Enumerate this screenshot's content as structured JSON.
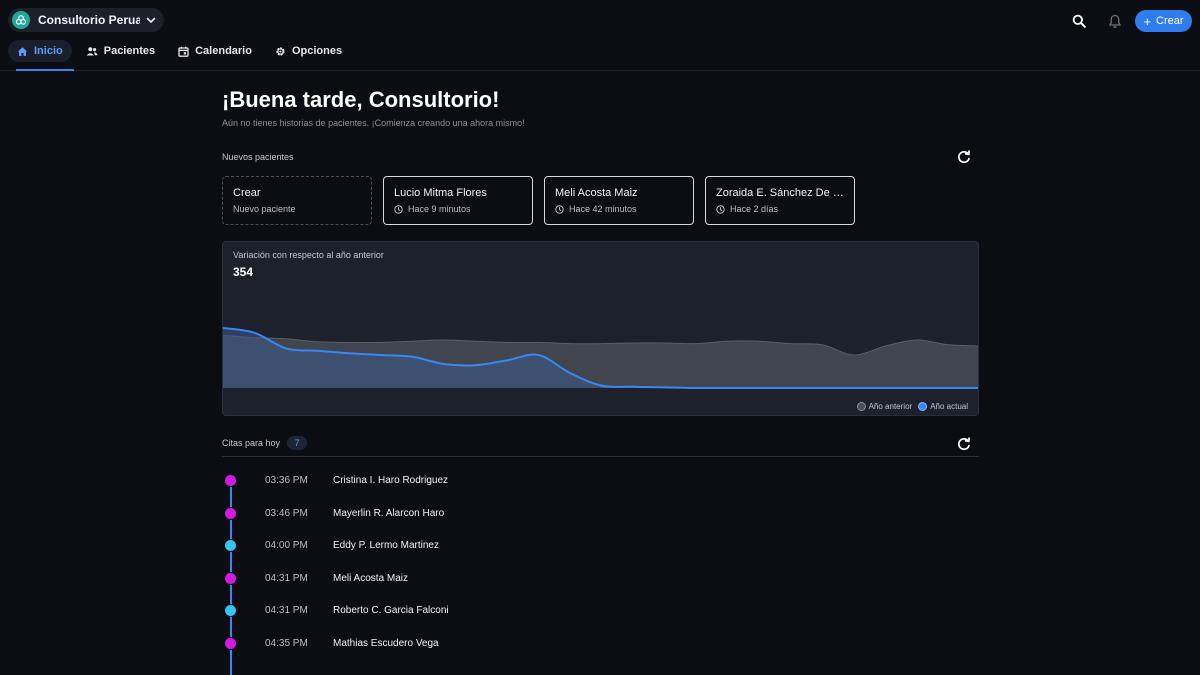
{
  "workspace": {
    "name": "Consultorio Peruan...",
    "logo": "clinic-logo-icon",
    "logo_color": "#1ea99a"
  },
  "header": {
    "create_label": "Crear",
    "accent": "#2f7cf0"
  },
  "tabs": [
    {
      "label": "Inicio",
      "icon": "home-icon",
      "active": true
    },
    {
      "label": "Pacientes",
      "icon": "users-icon"
    },
    {
      "label": "Calendario",
      "icon": "calendar-icon"
    },
    {
      "label": "Opciones",
      "icon": "gear-icon"
    }
  ],
  "greeting": "¡Buena tarde, Consultorio!",
  "subtitle": "Aún no tienes historias de pacientes. ¡Comienza creando una ahora mismo!",
  "new_patients": {
    "label": "Nuevos pacientes",
    "create_card": {
      "title": "Crear",
      "subtitle": "Nuevo paciente"
    },
    "items": [
      {
        "name": "Lucio Mitma Flores",
        "time": "Hace 9 minutos"
      },
      {
        "name": "Meli Acosta Maiz",
        "time": "Hace 42 minutos"
      },
      {
        "name": "Zoraida E. Sánchez De Hu...",
        "time": "Hace 2 días"
      }
    ]
  },
  "chart": {
    "title": "Variación con respecto al año anterior",
    "value": "354",
    "legend": {
      "previous": "Año anterior",
      "current": "Año actual"
    },
    "colors": {
      "previous": "#3f434c",
      "current": "#3a86f5"
    }
  },
  "chart_data": {
    "type": "area",
    "title": "Variación con respecto al año anterior",
    "series": [
      {
        "name": "Año anterior",
        "values": [
          0.88,
          0.84,
          0.82,
          0.77,
          0.76,
          0.76,
          0.78,
          0.8,
          0.78,
          0.76,
          0.76,
          0.74,
          0.74,
          0.75,
          0.75,
          0.74,
          0.78,
          0.78,
          0.74,
          0.72,
          0.55,
          0.7,
          0.8,
          0.72,
          0.7
        ]
      },
      {
        "name": "Año actual",
        "values": [
          1.0,
          0.92,
          0.66,
          0.62,
          0.58,
          0.55,
          0.52,
          0.4,
          0.38,
          0.46,
          0.55,
          0.25,
          0.04,
          0.02,
          0.01,
          0.0,
          0.0,
          0.0,
          0.0,
          0.0,
          0.0,
          0.0,
          0.0,
          0.0,
          0.0
        ]
      }
    ]
  },
  "appointments": {
    "label": "Citas para hoy",
    "count": "7",
    "items": [
      {
        "time": "03:36 PM",
        "name": "Cristina I. Haro Rodriguez",
        "color": "#d319e6"
      },
      {
        "time": "03:46 PM",
        "name": "Mayerlin R. Alarcon Haro",
        "color": "#d319e6"
      },
      {
        "time": "04:00 PM",
        "name": "Eddy P. Lermo Martinez",
        "color": "#33c6f0"
      },
      {
        "time": "04:31 PM",
        "name": "Meli Acosta Maiz",
        "color": "#d319e6"
      },
      {
        "time": "04:31 PM",
        "name": "Roberto C. Garcia Falconi",
        "color": "#33c6f0"
      },
      {
        "time": "04:35 PM",
        "name": "Mathias Escudero Vega",
        "color": "#d319e6"
      }
    ]
  }
}
